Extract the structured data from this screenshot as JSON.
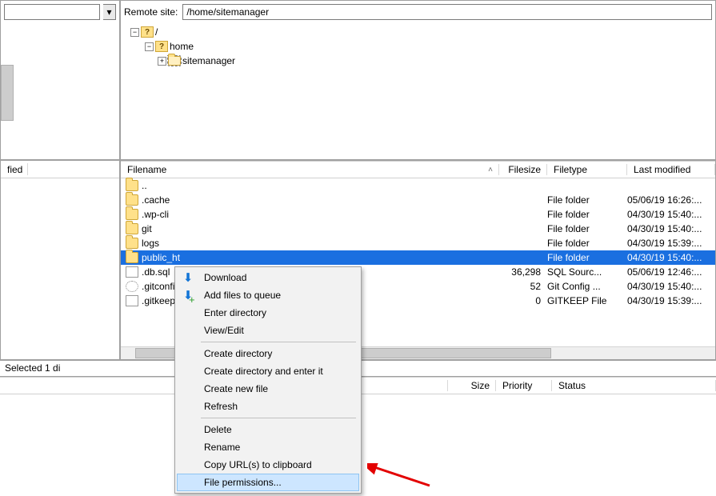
{
  "remote": {
    "label": "Remote site:",
    "path": "/home/sitemanager",
    "tree": {
      "root": "/",
      "home": "home",
      "sitemanager": "sitemanager"
    }
  },
  "local_header": {
    "fied": "fied"
  },
  "remote_list": {
    "headers": {
      "name": "Filename",
      "size": "Filesize",
      "type": "Filetype",
      "mod": "Last modified"
    },
    "rows": [
      {
        "icon": "folder",
        "name": "..",
        "size": "",
        "type": "",
        "mod": ""
      },
      {
        "icon": "folder",
        "name": ".cache",
        "size": "",
        "type": "File folder",
        "mod": "05/06/19 16:26:..."
      },
      {
        "icon": "folder",
        "name": ".wp-cli",
        "size": "",
        "type": "File folder",
        "mod": "04/30/19 15:40:..."
      },
      {
        "icon": "folder",
        "name": "git",
        "size": "",
        "type": "File folder",
        "mod": "04/30/19 15:40:..."
      },
      {
        "icon": "folder",
        "name": "logs",
        "size": "",
        "type": "File folder",
        "mod": "04/30/19 15:39:..."
      },
      {
        "icon": "folder",
        "name": "public_ht",
        "size": "",
        "type": "File folder",
        "mod": "04/30/19 15:40:...",
        "selected": true
      },
      {
        "icon": "file",
        "name": ".db.sql",
        "size": "36,298",
        "type": "SQL Sourc...",
        "mod": "05/06/19 12:46:..."
      },
      {
        "icon": "gear",
        "name": ".gitconfig",
        "size": "52",
        "type": "Git Config ...",
        "mod": "04/30/19 15:40:..."
      },
      {
        "icon": "file",
        "name": ".gitkeep",
        "size": "0",
        "type": "GITKEEP File",
        "mod": "04/30/19 15:39:..."
      }
    ],
    "status": "Selected 1 di"
  },
  "context_menu": {
    "items": [
      {
        "label": "Download",
        "icon": "download"
      },
      {
        "label": "Add files to queue",
        "icon": "queue"
      },
      {
        "label": "Enter directory"
      },
      {
        "label": "View/Edit",
        "disabled": true
      },
      {
        "sep": true
      },
      {
        "label": "Create directory"
      },
      {
        "label": "Create directory and enter it"
      },
      {
        "label": "Create new file"
      },
      {
        "label": "Refresh"
      },
      {
        "sep": true
      },
      {
        "label": "Delete"
      },
      {
        "label": "Rename"
      },
      {
        "label": "Copy URL(s) to clipboard"
      },
      {
        "label": "File permissions...",
        "hover": true
      }
    ]
  },
  "queue": {
    "headers": {
      "size": "Size",
      "priority": "Priority",
      "status": "Status"
    }
  }
}
